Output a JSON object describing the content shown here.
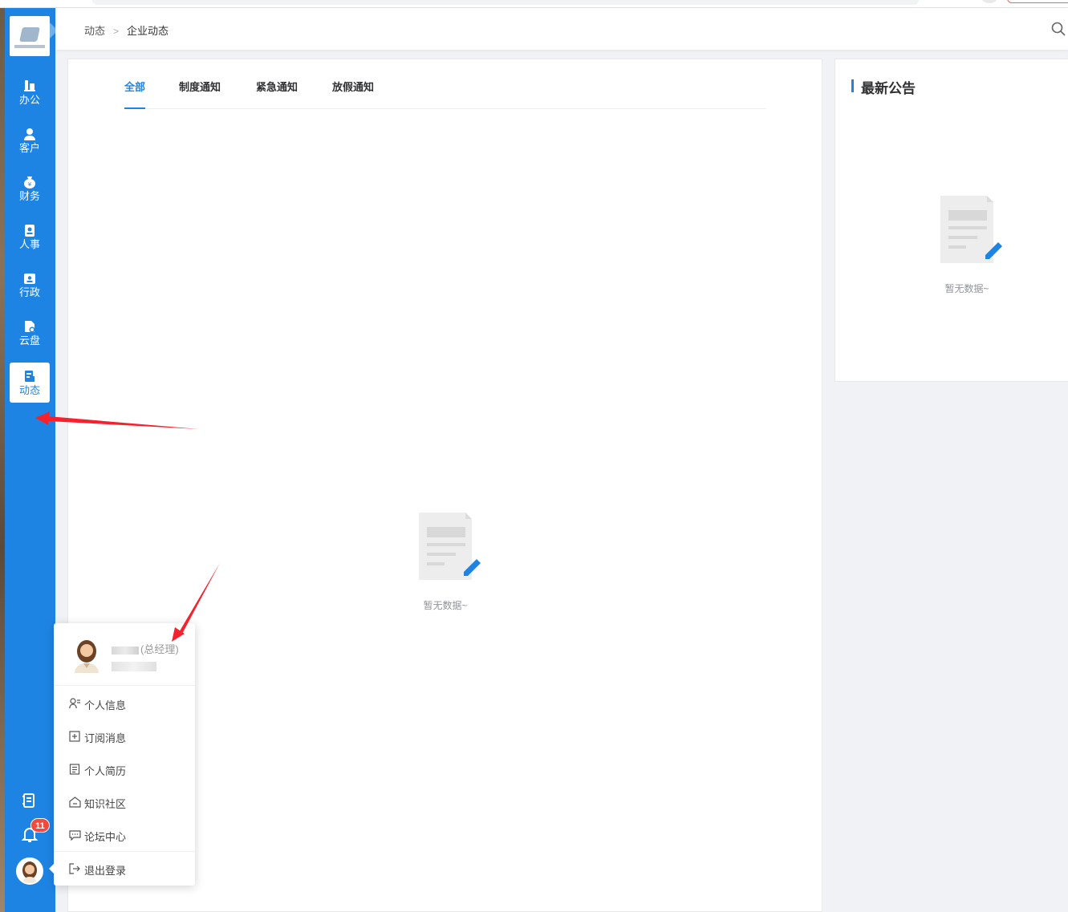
{
  "sidebar": {
    "nav": [
      {
        "label": "办公",
        "icon": "office-icon"
      },
      {
        "label": "客户",
        "icon": "customer-icon"
      },
      {
        "label": "财务",
        "icon": "finance-icon"
      },
      {
        "label": "人事",
        "icon": "hr-icon"
      },
      {
        "label": "行政",
        "icon": "admin-icon"
      },
      {
        "label": "云盘",
        "icon": "cloud-disk-icon"
      },
      {
        "label": "动态",
        "icon": "news-icon",
        "active": true
      }
    ],
    "notification_count": "11"
  },
  "header": {
    "breadcrumb": [
      "动态",
      "企业动态"
    ]
  },
  "main": {
    "tabs": [
      {
        "label": "全部",
        "active": true
      },
      {
        "label": "制度通知"
      },
      {
        "label": "紧急通知"
      },
      {
        "label": "放假通知"
      }
    ],
    "empty_text": "暂无数据~"
  },
  "announcements": {
    "title": "最新公告",
    "empty_text": "暂无数据~"
  },
  "user_menu": {
    "role": "(总经理)",
    "items": [
      {
        "label": "个人信息",
        "icon": "user-info-icon"
      },
      {
        "label": "订阅消息",
        "icon": "subscribe-icon"
      },
      {
        "label": "个人简历",
        "icon": "resume-icon"
      },
      {
        "label": "知识社区",
        "icon": "community-icon"
      },
      {
        "label": "论坛中心",
        "icon": "forum-icon"
      },
      {
        "label": "退出登录",
        "icon": "logout-icon"
      }
    ]
  },
  "colors": {
    "primary": "#1e84e4",
    "badge": "#f04b3d",
    "annotation": "#f5222d"
  }
}
